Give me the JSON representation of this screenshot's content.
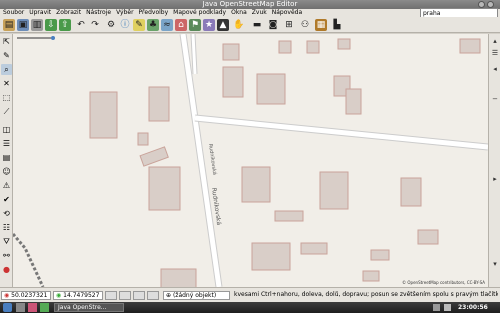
{
  "window": {
    "title": "Java OpenStreetMap Editor"
  },
  "menu": [
    "Soubor",
    "Upravit",
    "Zobrazit",
    "Nástroje",
    "Výběr",
    "Předvolby",
    "Mapové podklady",
    "Okna",
    "Zvuk",
    "Nápověda"
  ],
  "search": {
    "value": "praha"
  },
  "map": {
    "street_label": "Rudníkovská",
    "attribution": "© OpenStreetMap contributors, CC-BY-SA"
  },
  "status": {
    "lat": "50.0237321",
    "lon": "14.7479527",
    "selection": "(žádný objekt)",
    "hint": "kvesami Ctrl+nahoru, doleva, dolů, dopravu; posun se zvětšením spolu s pravým tlačítkem myši"
  },
  "taskbar": {
    "app": "Java OpenStre...",
    "clock": "23:00:56"
  },
  "colors": {
    "building_fill": "#d9cec8",
    "building_stroke": "#c9a39a",
    "map_bg": "#f1eee8"
  }
}
